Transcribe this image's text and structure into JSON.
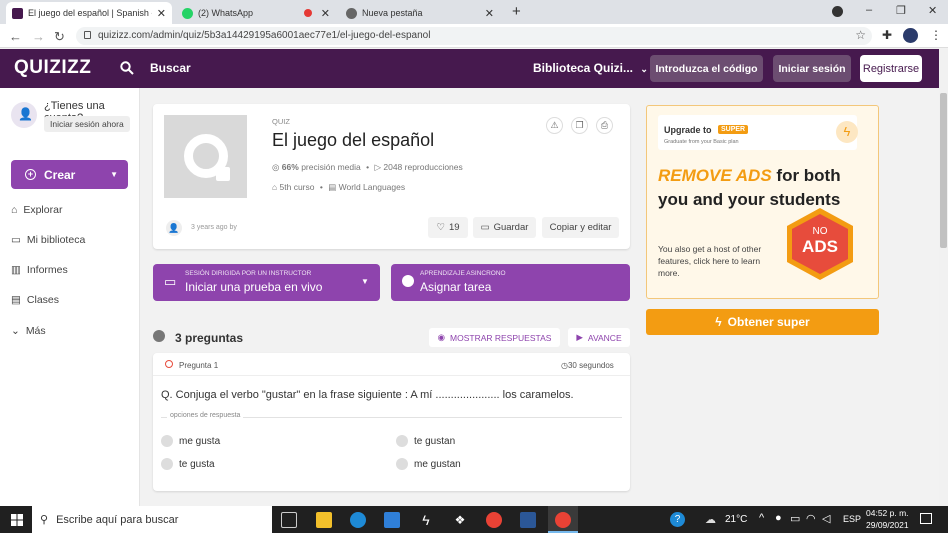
{
  "browser": {
    "tabs": [
      {
        "label": "El juego del español | Spanish - Q",
        "active": true
      },
      {
        "label": "(2) WhatsApp",
        "active": false
      },
      {
        "label": "Nueva pestaña",
        "active": false
      }
    ],
    "new_tab": "+",
    "window_controls": [
      "–",
      "❐",
      "✕"
    ],
    "url": "quizizz.com/admin/quiz/5b3a14429195a6001aec77e1/el-juego-del-espanol"
  },
  "header": {
    "logo": "QUIZIZZ",
    "search_placeholder": "Buscar",
    "library": "Biblioteca Quizi...",
    "enter_code": "Introduzca el código",
    "login": "Iniciar sesión",
    "register": "Registrarse"
  },
  "sidebar": {
    "account_question": "¿Tienes una cuenta?",
    "login_now": "Iniciar sesión ahora",
    "create": "Crear",
    "items": [
      "Explorar",
      "Mi biblioteca",
      "Informes",
      "Clases",
      "Más"
    ]
  },
  "quiz": {
    "type": "QUIZ",
    "title": "El juego del español",
    "accuracy": "66%",
    "accuracy_label": "precisión media",
    "plays": "2048 reproducciones",
    "grade": "5th curso",
    "subject": "World Languages",
    "author_meta": "3 years ago by",
    "likes": "19",
    "save": "Guardar",
    "copy_edit": "Copiar y editar"
  },
  "actions": {
    "live_small": "SESIÓN DIRIGIDA POR UN INSTRUCTOR",
    "live": "Iniciar una prueba en vivo",
    "async_small": "APRENDIZAJE ASINCRONO",
    "async": "Asignar tarea"
  },
  "questions": {
    "count": "3 preguntas",
    "show_answers": "MOSTRAR RESPUESTAS",
    "preview": "AVANCE",
    "q1": {
      "label": "Pregunta 1",
      "time": "30 segundos",
      "text": "Q. Conjuga el verbo \"gustar\" en la frase siguiente : A mí ..................... los caramelos.",
      "options_label": "opciones de respuesta",
      "options": [
        "me gusta",
        "te gustan",
        "te gusta",
        "me gustan"
      ]
    }
  },
  "ad": {
    "upgrade": "Upgrade to",
    "super_badge": "SUPER",
    "grad": "Graduate from your Basic plan",
    "remove_ads": "REMOVE ADS",
    "headline_rest": "for both you and your students",
    "body": "You also get a host of other features, click here to learn more.",
    "no": "NO",
    "ads": "ADS",
    "cta": "Obtener super"
  },
  "taskbar": {
    "search": "Escribe aquí para buscar",
    "weather": "21°C",
    "lang": "ESP",
    "time": "04:52 p. m.",
    "date": "29/09/2021"
  },
  "colors": {
    "quizizz_header": "#46194e",
    "purple": "#8e44ad",
    "super_orange": "#f39c12",
    "ads_red": "#e74c3c"
  }
}
